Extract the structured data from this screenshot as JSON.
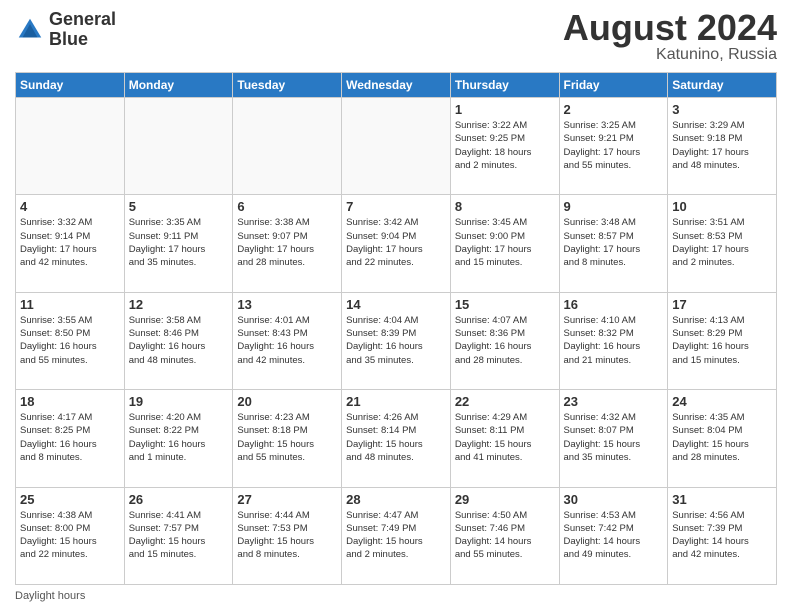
{
  "header": {
    "logo_line1": "General",
    "logo_line2": "Blue",
    "month": "August 2024",
    "location": "Katunino, Russia"
  },
  "days_of_week": [
    "Sunday",
    "Monday",
    "Tuesday",
    "Wednesday",
    "Thursday",
    "Friday",
    "Saturday"
  ],
  "footer_note": "Daylight hours",
  "weeks": [
    [
      {
        "day": "",
        "info": ""
      },
      {
        "day": "",
        "info": ""
      },
      {
        "day": "",
        "info": ""
      },
      {
        "day": "",
        "info": ""
      },
      {
        "day": "1",
        "info": "Sunrise: 3:22 AM\nSunset: 9:25 PM\nDaylight: 18 hours\nand 2 minutes."
      },
      {
        "day": "2",
        "info": "Sunrise: 3:25 AM\nSunset: 9:21 PM\nDaylight: 17 hours\nand 55 minutes."
      },
      {
        "day": "3",
        "info": "Sunrise: 3:29 AM\nSunset: 9:18 PM\nDaylight: 17 hours\nand 48 minutes."
      }
    ],
    [
      {
        "day": "4",
        "info": "Sunrise: 3:32 AM\nSunset: 9:14 PM\nDaylight: 17 hours\nand 42 minutes."
      },
      {
        "day": "5",
        "info": "Sunrise: 3:35 AM\nSunset: 9:11 PM\nDaylight: 17 hours\nand 35 minutes."
      },
      {
        "day": "6",
        "info": "Sunrise: 3:38 AM\nSunset: 9:07 PM\nDaylight: 17 hours\nand 28 minutes."
      },
      {
        "day": "7",
        "info": "Sunrise: 3:42 AM\nSunset: 9:04 PM\nDaylight: 17 hours\nand 22 minutes."
      },
      {
        "day": "8",
        "info": "Sunrise: 3:45 AM\nSunset: 9:00 PM\nDaylight: 17 hours\nand 15 minutes."
      },
      {
        "day": "9",
        "info": "Sunrise: 3:48 AM\nSunset: 8:57 PM\nDaylight: 17 hours\nand 8 minutes."
      },
      {
        "day": "10",
        "info": "Sunrise: 3:51 AM\nSunset: 8:53 PM\nDaylight: 17 hours\nand 2 minutes."
      }
    ],
    [
      {
        "day": "11",
        "info": "Sunrise: 3:55 AM\nSunset: 8:50 PM\nDaylight: 16 hours\nand 55 minutes."
      },
      {
        "day": "12",
        "info": "Sunrise: 3:58 AM\nSunset: 8:46 PM\nDaylight: 16 hours\nand 48 minutes."
      },
      {
        "day": "13",
        "info": "Sunrise: 4:01 AM\nSunset: 8:43 PM\nDaylight: 16 hours\nand 42 minutes."
      },
      {
        "day": "14",
        "info": "Sunrise: 4:04 AM\nSunset: 8:39 PM\nDaylight: 16 hours\nand 35 minutes."
      },
      {
        "day": "15",
        "info": "Sunrise: 4:07 AM\nSunset: 8:36 PM\nDaylight: 16 hours\nand 28 minutes."
      },
      {
        "day": "16",
        "info": "Sunrise: 4:10 AM\nSunset: 8:32 PM\nDaylight: 16 hours\nand 21 minutes."
      },
      {
        "day": "17",
        "info": "Sunrise: 4:13 AM\nSunset: 8:29 PM\nDaylight: 16 hours\nand 15 minutes."
      }
    ],
    [
      {
        "day": "18",
        "info": "Sunrise: 4:17 AM\nSunset: 8:25 PM\nDaylight: 16 hours\nand 8 minutes."
      },
      {
        "day": "19",
        "info": "Sunrise: 4:20 AM\nSunset: 8:22 PM\nDaylight: 16 hours\nand 1 minute."
      },
      {
        "day": "20",
        "info": "Sunrise: 4:23 AM\nSunset: 8:18 PM\nDaylight: 15 hours\nand 55 minutes."
      },
      {
        "day": "21",
        "info": "Sunrise: 4:26 AM\nSunset: 8:14 PM\nDaylight: 15 hours\nand 48 minutes."
      },
      {
        "day": "22",
        "info": "Sunrise: 4:29 AM\nSunset: 8:11 PM\nDaylight: 15 hours\nand 41 minutes."
      },
      {
        "day": "23",
        "info": "Sunrise: 4:32 AM\nSunset: 8:07 PM\nDaylight: 15 hours\nand 35 minutes."
      },
      {
        "day": "24",
        "info": "Sunrise: 4:35 AM\nSunset: 8:04 PM\nDaylight: 15 hours\nand 28 minutes."
      }
    ],
    [
      {
        "day": "25",
        "info": "Sunrise: 4:38 AM\nSunset: 8:00 PM\nDaylight: 15 hours\nand 22 minutes."
      },
      {
        "day": "26",
        "info": "Sunrise: 4:41 AM\nSunset: 7:57 PM\nDaylight: 15 hours\nand 15 minutes."
      },
      {
        "day": "27",
        "info": "Sunrise: 4:44 AM\nSunset: 7:53 PM\nDaylight: 15 hours\nand 8 minutes."
      },
      {
        "day": "28",
        "info": "Sunrise: 4:47 AM\nSunset: 7:49 PM\nDaylight: 15 hours\nand 2 minutes."
      },
      {
        "day": "29",
        "info": "Sunrise: 4:50 AM\nSunset: 7:46 PM\nDaylight: 14 hours\nand 55 minutes."
      },
      {
        "day": "30",
        "info": "Sunrise: 4:53 AM\nSunset: 7:42 PM\nDaylight: 14 hours\nand 49 minutes."
      },
      {
        "day": "31",
        "info": "Sunrise: 4:56 AM\nSunset: 7:39 PM\nDaylight: 14 hours\nand 42 minutes."
      }
    ]
  ]
}
